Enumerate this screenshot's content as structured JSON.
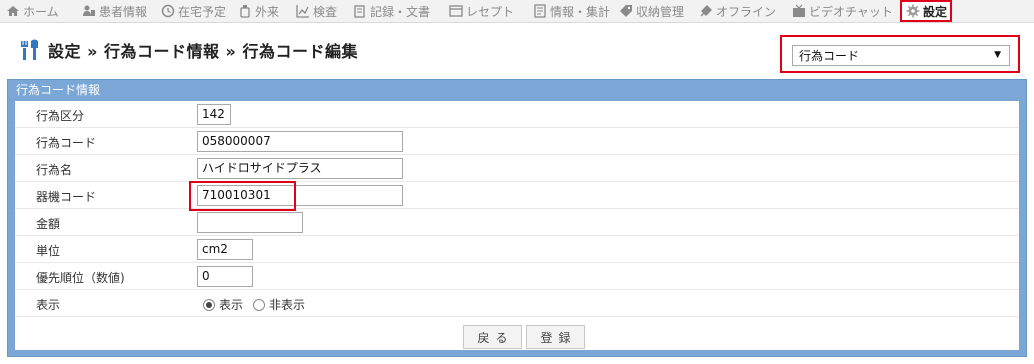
{
  "nav": {
    "items": [
      {
        "label": "ホーム",
        "icon": "home-icon"
      },
      {
        "label": "患者情報",
        "icon": "patient-icon"
      },
      {
        "label": "在宅予定",
        "icon": "clock-icon"
      },
      {
        "label": "外来",
        "icon": "bottle-icon"
      },
      {
        "label": "検査",
        "icon": "chart-icon"
      },
      {
        "label": "記録・文書",
        "icon": "document-icon"
      },
      {
        "label": "レセプト",
        "icon": "receipt-icon"
      },
      {
        "label": "情報・集計",
        "icon": "report-icon"
      },
      {
        "label": "収納管理",
        "icon": "tag-icon"
      },
      {
        "label": "オフライン",
        "icon": "plug-icon"
      },
      {
        "label": "ビデオチャット",
        "icon": "video-icon"
      },
      {
        "label": "設定",
        "icon": "gear-icon"
      }
    ],
    "active_index": 11
  },
  "heading": {
    "title": "設定 » 行為コード情報 » 行為コード編集"
  },
  "select": {
    "value": "行為コード"
  },
  "panel": {
    "title": "行為コード情報",
    "fields": {
      "kubun": {
        "label": "行為区分",
        "value": "142"
      },
      "code": {
        "label": "行為コード",
        "value": "058000007"
      },
      "name": {
        "label": "行為名",
        "value": "ハイドロサイドプラス"
      },
      "kiki": {
        "label": "器機コード",
        "value": "710010301"
      },
      "kingaku": {
        "label": "金額",
        "value": ""
      },
      "tani": {
        "label": "単位",
        "value": "cm2"
      },
      "yusen": {
        "label": "優先順位（数値)",
        "value": "0"
      },
      "hyoji": {
        "label": "表示",
        "options": [
          "表示",
          "非表示"
        ],
        "selected": "表示"
      }
    },
    "buttons": {
      "back": "戻る",
      "register": "登録"
    }
  },
  "colors": {
    "panel_blue": "#7aa7d6",
    "highlight_red": "#e0001a"
  }
}
